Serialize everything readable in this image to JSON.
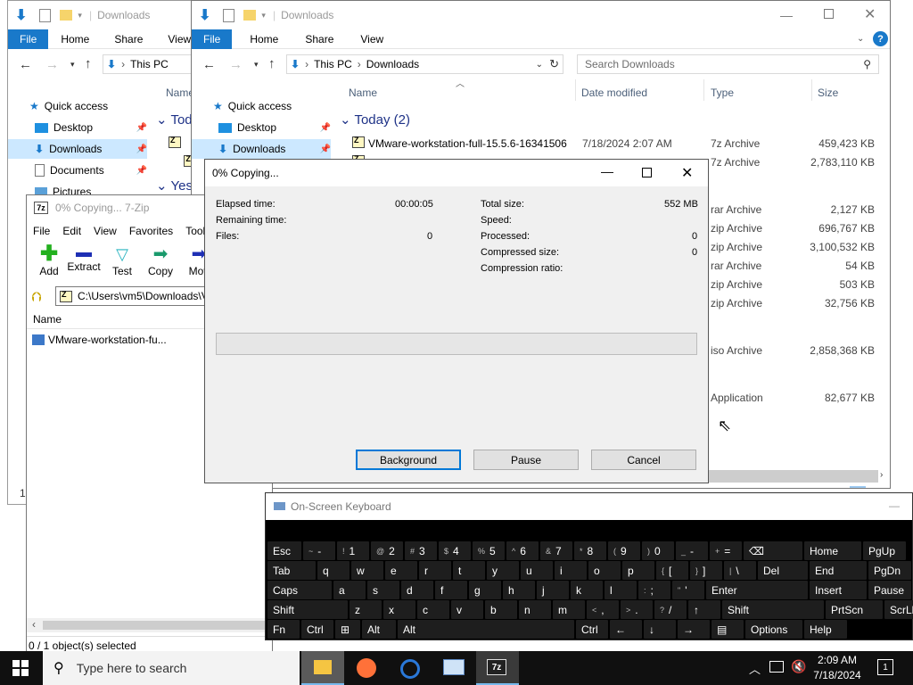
{
  "explorer_back": {
    "title": "Downloads",
    "tabs": [
      "File",
      "Home",
      "Share",
      "View"
    ],
    "address": "This PC",
    "column_name": "Name",
    "group_today": "Tod",
    "group_yesterday": "Yest",
    "nav": [
      "Quick access",
      "Desktop",
      "Downloads",
      "Documents",
      "Pictures"
    ]
  },
  "explorer_front": {
    "title": "Downloads",
    "tabs": [
      "File",
      "Home",
      "Share",
      "View"
    ],
    "address": [
      "This PC",
      "Downloads"
    ],
    "search_placeholder": "Search Downloads",
    "columns": [
      "Name",
      "Date modified",
      "Type",
      "Size"
    ],
    "group_today": "Today (2)",
    "nav": [
      "Quick access",
      "Desktop",
      "Downloads"
    ],
    "rows": [
      {
        "name": "VMware-workstation-full-15.5.6-16341506",
        "date": "7/18/2024 2:07 AM",
        "type": "7z Archive",
        "size": "459,423 KB"
      },
      {
        "name": "",
        "date": "",
        "type": "7z Archive",
        "size": "2,783,110 KB"
      },
      {
        "name": "",
        "date": "",
        "type": "rar Archive",
        "size": "2,127 KB"
      },
      {
        "name": "",
        "date": "",
        "type": "zip Archive",
        "size": "696,767 KB"
      },
      {
        "name": "",
        "date": "",
        "type": "zip Archive",
        "size": "3,100,532 KB"
      },
      {
        "name": "",
        "date": "",
        "type": "rar Archive",
        "size": "54 KB"
      },
      {
        "name": "",
        "date": "",
        "type": "zip Archive",
        "size": "503 KB"
      },
      {
        "name": "",
        "date": "",
        "type": "zip Archive",
        "size": "32,756 KB"
      },
      {
        "name": "",
        "date": "",
        "type": "iso Archive",
        "size": "2,858,368 KB"
      },
      {
        "name": "",
        "date": "",
        "type": "Application",
        "size": "82,677 KB"
      }
    ]
  },
  "sevenzip": {
    "title": "0% Copying... 7-Zip",
    "menu": [
      "File",
      "Edit",
      "View",
      "Favorites",
      "Tools"
    ],
    "toolbar": [
      "Add",
      "Extract",
      "Test",
      "Copy",
      "Mov"
    ],
    "path": "C:\\Users\\vm5\\Downloads\\V",
    "column_name": "Name",
    "file": "VMware-workstation-fu...",
    "status": "0 / 1 object(s) selected",
    "left_edge": "1"
  },
  "progress": {
    "title": "0% Copying...",
    "percent": 0,
    "left_labels": [
      "Elapsed time:",
      "Remaining time:",
      "Files:"
    ],
    "left_values": [
      "00:00:05",
      "",
      "0"
    ],
    "right_labels": [
      "Total size:",
      "Speed:",
      "Processed:",
      "Compressed size:",
      "Compression ratio:"
    ],
    "right_values": [
      "552 MB",
      "",
      "0",
      "0",
      ""
    ],
    "buttons": [
      "Background",
      "Pause",
      "Cancel"
    ]
  },
  "keyboard": {
    "title": "On-Screen Keyboard",
    "rows": [
      [
        [
          "Esc",
          ""
        ],
        [
          "-",
          "~"
        ],
        [
          "1",
          "!"
        ],
        [
          "2",
          "@"
        ],
        [
          "3",
          "#"
        ],
        [
          "4",
          "$"
        ],
        [
          "5",
          "%"
        ],
        [
          "6",
          "^"
        ],
        [
          "7",
          "&"
        ],
        [
          "8",
          "*"
        ],
        [
          "9",
          "("
        ],
        [
          "0",
          ")"
        ],
        [
          "-",
          "_"
        ],
        [
          "=",
          "+"
        ],
        [
          "⌫",
          ""
        ],
        [
          "Home",
          ""
        ],
        [
          "PgUp",
          ""
        ]
      ],
      [
        [
          "Tab",
          ""
        ],
        [
          "q",
          ""
        ],
        [
          "w",
          ""
        ],
        [
          "e",
          ""
        ],
        [
          "r",
          ""
        ],
        [
          "t",
          ""
        ],
        [
          "y",
          ""
        ],
        [
          "u",
          ""
        ],
        [
          "i",
          ""
        ],
        [
          "o",
          ""
        ],
        [
          "p",
          ""
        ],
        [
          "[",
          "{"
        ],
        [
          "]",
          "}"
        ],
        [
          "\\",
          "|"
        ],
        [
          "Del",
          ""
        ],
        [
          "End",
          ""
        ],
        [
          "PgDn",
          ""
        ]
      ],
      [
        [
          "Caps",
          ""
        ],
        [
          "a",
          ""
        ],
        [
          "s",
          ""
        ],
        [
          "d",
          ""
        ],
        [
          "f",
          ""
        ],
        [
          "g",
          ""
        ],
        [
          "h",
          ""
        ],
        [
          "j",
          ""
        ],
        [
          "k",
          ""
        ],
        [
          "l",
          ""
        ],
        [
          ";",
          ":"
        ],
        [
          "'",
          "\""
        ],
        [
          "Enter",
          ""
        ],
        [
          "Insert",
          ""
        ],
        [
          "Pause",
          ""
        ]
      ],
      [
        [
          "Shift",
          ""
        ],
        [
          "z",
          ""
        ],
        [
          "x",
          ""
        ],
        [
          "c",
          ""
        ],
        [
          "v",
          ""
        ],
        [
          "b",
          ""
        ],
        [
          "n",
          ""
        ],
        [
          "m",
          ""
        ],
        [
          ",",
          "<"
        ],
        [
          ".",
          ">"
        ],
        [
          "/",
          "?"
        ],
        [
          "↑",
          ""
        ],
        [
          "Shift",
          ""
        ],
        [
          "PrtScn",
          ""
        ],
        [
          "ScrLk",
          ""
        ]
      ],
      [
        [
          "Fn",
          ""
        ],
        [
          "Ctrl",
          ""
        ],
        [
          "⊞",
          ""
        ],
        [
          "Alt",
          ""
        ],
        [
          "Alt",
          ""
        ],
        [
          "Ctrl",
          ""
        ],
        [
          "←",
          ""
        ],
        [
          "↓",
          ""
        ],
        [
          "→",
          ""
        ],
        [
          "▤",
          ""
        ],
        [
          "Options",
          ""
        ],
        [
          "Help",
          ""
        ]
      ]
    ]
  },
  "taskbar": {
    "search_placeholder": "Type here to search",
    "time": "2:09 AM",
    "date": "7/18/2024",
    "notification_count": "1"
  }
}
